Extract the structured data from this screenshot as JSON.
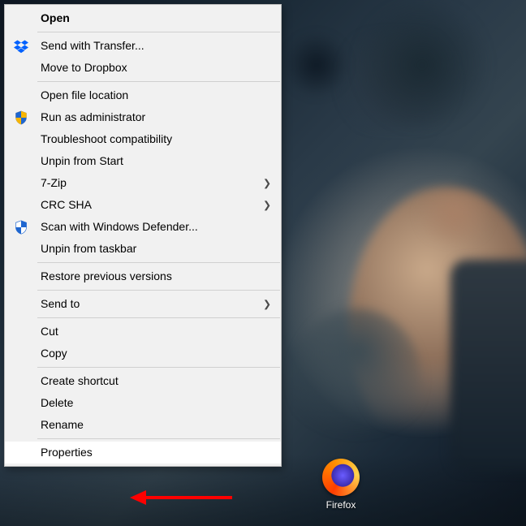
{
  "desktop": {
    "icon": {
      "label": "Firefox"
    }
  },
  "menu": {
    "open": "Open",
    "send_transfer": "Send with Transfer...",
    "move_dropbox": "Move to Dropbox",
    "open_location": "Open file location",
    "run_admin": "Run as administrator",
    "troubleshoot": "Troubleshoot compatibility",
    "unpin_start": "Unpin from Start",
    "seven_zip": "7-Zip",
    "crc_sha": "CRC SHA",
    "scan_defender": "Scan with Windows Defender...",
    "unpin_taskbar": "Unpin from taskbar",
    "restore_prev": "Restore previous versions",
    "send_to": "Send to",
    "cut": "Cut",
    "copy": "Copy",
    "create_shortcut": "Create shortcut",
    "delete": "Delete",
    "rename": "Rename",
    "properties": "Properties"
  }
}
